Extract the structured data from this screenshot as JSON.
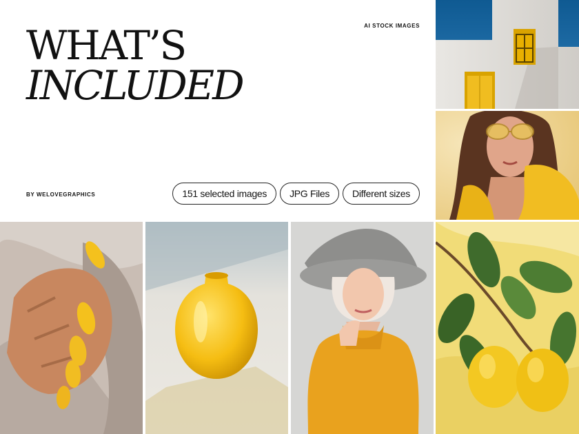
{
  "header": {
    "title_line1": "WHAT’S",
    "title_line2": "INCLUDED",
    "kicker": "AI STOCK IMAGES",
    "byline": "BY WELOVEGRAPHICS"
  },
  "badges": [
    "151 selected images",
    "JPG Files",
    "Different sizes"
  ],
  "photos": [
    {
      "subject": "white-building-yellow-door"
    },
    {
      "subject": "woman-yellow-sunglasses"
    },
    {
      "subject": "yellow-nails-sweater"
    },
    {
      "subject": "yellow-glass-vase"
    },
    {
      "subject": "woman-grey-hat-yellow-sweater"
    },
    {
      "subject": "lemons-on-yellow-cloth"
    }
  ],
  "colors": {
    "accent": "#f1bd22",
    "text": "#111111",
    "background": "#ffffff"
  }
}
